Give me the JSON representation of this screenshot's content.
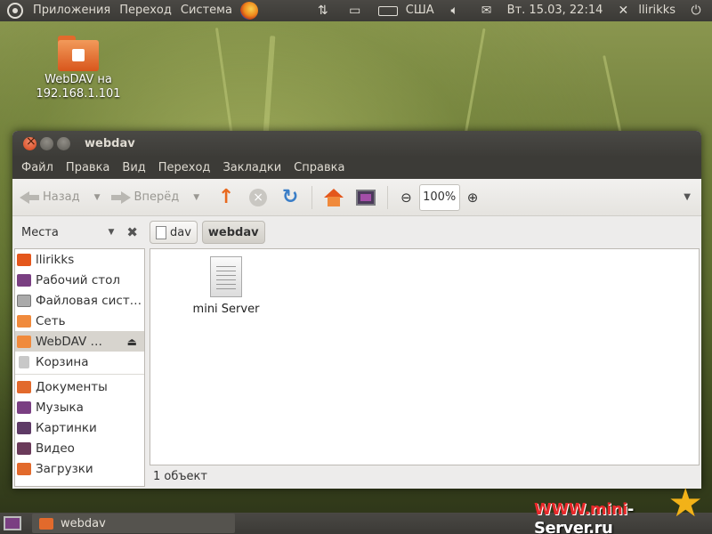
{
  "top_panel": {
    "menus": [
      "Приложения",
      "Переход",
      "Система"
    ],
    "keyboard_layout": "США",
    "datetime": "Вт. 15.03, 22:14",
    "username": "llirikks"
  },
  "desktop": {
    "icon_label": "WebDAV на 192.168.1.101"
  },
  "window": {
    "title": "webdav",
    "menu": [
      "Файл",
      "Правка",
      "Вид",
      "Переход",
      "Закладки",
      "Справка"
    ],
    "toolbar": {
      "back_label": "Назад",
      "forward_label": "Вперёд",
      "zoom_value": "100%"
    },
    "places_label": "Места",
    "breadcrumbs": [
      "dav",
      "webdav"
    ],
    "sidebar": {
      "items": [
        {
          "label": "llirikks",
          "icon": "home-folder-icon"
        },
        {
          "label": "Рабочий стол",
          "icon": "desktop-icon"
        },
        {
          "label": "Файловая сист…",
          "icon": "harddisk-icon"
        },
        {
          "label": "Сеть",
          "icon": "network-icon"
        },
        {
          "label": "WebDAV …",
          "icon": "webdav-icon"
        },
        {
          "label": "Корзина",
          "icon": "trash-icon"
        }
      ],
      "bookmarks": [
        {
          "label": "Документы",
          "icon": "documents-folder-icon"
        },
        {
          "label": "Музыка",
          "icon": "music-folder-icon"
        },
        {
          "label": "Картинки",
          "icon": "pictures-folder-icon"
        },
        {
          "label": "Видео",
          "icon": "videos-folder-icon"
        },
        {
          "label": "Загрузки",
          "icon": "downloads-folder-icon"
        }
      ]
    },
    "files": [
      {
        "name": "mini Server",
        "icon": "text-file-icon"
      }
    ],
    "status": "1 объект"
  },
  "taskbar": {
    "task_label": "webdav"
  },
  "watermark": {
    "prefix": "WWW.mini",
    "suffix": "Server.ru"
  }
}
